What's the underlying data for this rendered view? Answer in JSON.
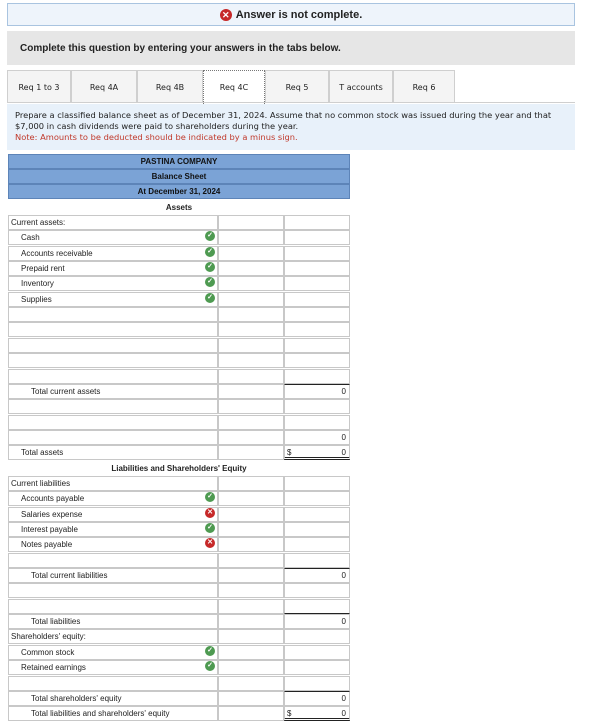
{
  "banner": {
    "text": "Answer is not complete."
  },
  "instruction": "Complete this question by entering your answers in the tabs below.",
  "tabs": [
    {
      "label": "Req 1 to 3"
    },
    {
      "label": "Req 4A"
    },
    {
      "label": "Req 4B"
    },
    {
      "label": "Req 4C",
      "active": true
    },
    {
      "label": "Req 5"
    },
    {
      "label": "T accounts"
    },
    {
      "label": "Req 6"
    }
  ],
  "prompt": {
    "text": "Prepare a classified balance sheet as of December 31, 2024. Assume that no common stock was issued during the year and that $7,000 in cash dividends were paid to shareholders during the year.",
    "note": "Note: Amounts to be deducted should be indicated by a minus sign."
  },
  "sheet": {
    "company": "PASTINA COMPANY",
    "statement": "Balance Sheet",
    "date": "At December 31, 2024",
    "assets_heading": "Assets",
    "liab_heading": "Liabilities and Shareholders' Equity",
    "rows": [
      {
        "label": "Current assets:",
        "indent": 0
      },
      {
        "label": "Cash",
        "indent": 1,
        "status": "ok"
      },
      {
        "label": "Accounts receivable",
        "indent": 1,
        "status": "ok"
      },
      {
        "label": "Prepaid rent",
        "indent": 1,
        "status": "ok"
      },
      {
        "label": "Inventory",
        "indent": 1,
        "status": "ok"
      },
      {
        "label": "Supplies",
        "indent": 1,
        "status": "ok"
      },
      {
        "label": "",
        "indent": 1
      },
      {
        "label": "",
        "indent": 1
      },
      {
        "label": "",
        "indent": 1
      },
      {
        "label": "",
        "indent": 1
      },
      {
        "label": "",
        "indent": 1
      },
      {
        "label": "Total current assets",
        "indent": 2,
        "value": "0",
        "style": "top"
      },
      {
        "label": "",
        "indent": 1
      },
      {
        "label": "",
        "indent": 1
      },
      {
        "label": "",
        "indent": 1,
        "value": "0"
      },
      {
        "label": "Total assets",
        "indent": 1,
        "value": "0",
        "dollar": "$",
        "style": "dbl"
      },
      {
        "section": "liab"
      },
      {
        "label": "Current liabilities",
        "indent": 0
      },
      {
        "label": "Accounts payable",
        "indent": 1,
        "status": "ok"
      },
      {
        "label": "Salaries expense",
        "indent": 1,
        "status": "bad"
      },
      {
        "label": "Interest payable",
        "indent": 1,
        "status": "ok"
      },
      {
        "label": "Notes payable",
        "indent": 1,
        "status": "bad"
      },
      {
        "label": "",
        "indent": 1
      },
      {
        "label": "Total current liabilities",
        "indent": 2,
        "value": "0",
        "style": "top"
      },
      {
        "label": "",
        "indent": 1
      },
      {
        "label": "",
        "indent": 1,
        "style": "ul"
      },
      {
        "label": "Total liabilities",
        "indent": 2,
        "value": "0"
      },
      {
        "label": "Shareholders' equity:",
        "indent": 0
      },
      {
        "label": "Common stock",
        "indent": 1,
        "status": "ok"
      },
      {
        "label": "Retained earnings",
        "indent": 1,
        "status": "ok"
      },
      {
        "label": "",
        "indent": 1
      },
      {
        "label": "Total shareholders' equity",
        "indent": 2,
        "value": "0",
        "style": "top"
      },
      {
        "label": "Total liabilities and shareholders' equity",
        "indent": 2,
        "value": "0",
        "dollar": "$",
        "style": "dbl"
      }
    ]
  }
}
